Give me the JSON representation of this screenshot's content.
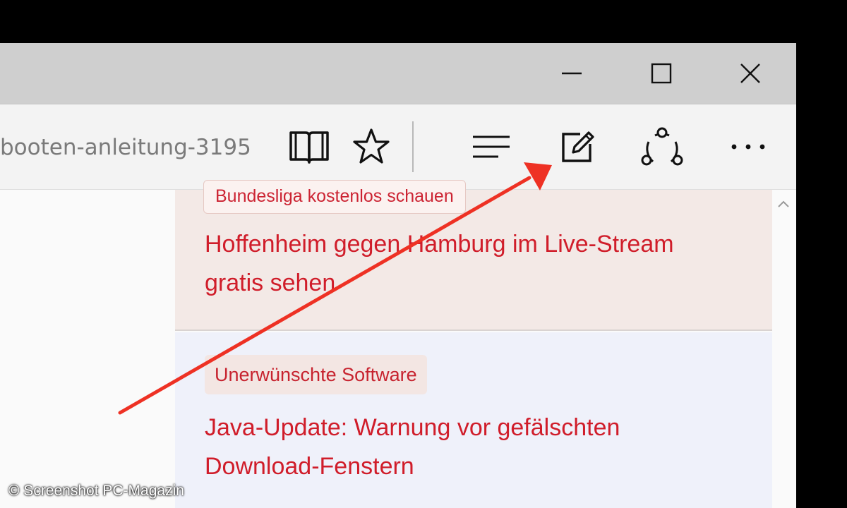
{
  "toolbar": {
    "address_text": "booten-anleitung-3195",
    "icons": [
      "reading-view-icon",
      "favorites-star-icon",
      "hub-icon",
      "web-note-icon",
      "share-icon",
      "more-icon"
    ]
  },
  "window_controls": [
    "minimize-icon",
    "maximize-icon",
    "close-icon"
  ],
  "articles": [
    {
      "tag": "Bundesliga kostenlos schauen",
      "headline_line1": "Hoffenheim gegen Hamburg im Live-Stream",
      "headline_line2": "gratis sehen"
    },
    {
      "tag": "Unerwünschte Software",
      "headline_line1": "Java-Update: Warnung vor gefälschten",
      "headline_line2": "Download-Fenstern"
    }
  ],
  "annotation": {
    "arrow_color": "#ee3124"
  },
  "copyright": "© Screenshot PC-Magazin",
  "colors": {
    "accent_red": "#d01d2a",
    "titlebar": "#cfcfcf",
    "toolbar": "#f3f3f3"
  }
}
